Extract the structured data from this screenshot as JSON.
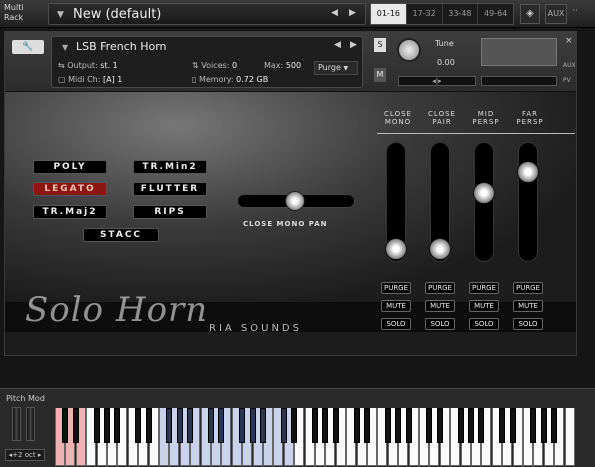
{
  "rack": {
    "label_line1": "Multi",
    "label_line2": "Rack",
    "preset_name": "New (default)",
    "nav_prev": "◀",
    "nav_next": "▶",
    "banks": [
      "01-16",
      "17-32",
      "33-48",
      "49-64"
    ],
    "active_bank": "01-16",
    "aux_label": "AUX",
    "more": "··"
  },
  "instrument": {
    "name": "LSB French Horn",
    "output_label": "Output:",
    "output_value": "st. 1",
    "midi_label": "Midi Ch:",
    "midi_value": "[A] 1",
    "voices_label": "Voices:",
    "voices_value": "0",
    "max_label": "Max:",
    "max_value": "500",
    "memory_label": "Memory:",
    "memory_value": "0.72 GB",
    "purge_label": "Purge",
    "s_label": "S",
    "m_label": "M",
    "tune_label": "Tune",
    "tune_value": "0.00",
    "pan_value": "◂|▸",
    "close_label": "×",
    "aux_mini": "AUX",
    "pv_label": "PV"
  },
  "mics": [
    {
      "line1": "CLOSE",
      "line2": "MONO",
      "level": 0.1
    },
    {
      "line1": "CLOSE",
      "line2": "PAIR",
      "level": 0.1
    },
    {
      "line1": "MID",
      "line2": "PERSP",
      "level": 0.55
    },
    {
      "line1": "FAR",
      "line2": "PERSP",
      "level": 0.8
    }
  ],
  "articulations": {
    "poly": "POLY",
    "legato": "LEGATO",
    "trmaj2": "TR.Maj2",
    "trmin2": "TR.Min2",
    "flutter": "FLUTTER",
    "rips": "RIPS",
    "stacc": "STACC",
    "active": "LEGATO"
  },
  "pan_slider": {
    "label": "CLOSE MONO PAN",
    "value": 0.5
  },
  "mic_buttons": {
    "purge": "PURGE",
    "mute": "MUTE",
    "solo": "SOLO"
  },
  "logo": {
    "title": "Solo Horn",
    "subtitle": "RIA SOUNDS"
  },
  "keyboard": {
    "pitch_mod_label": "Pitch Mod",
    "octave_label": "◂+2 oct ▸",
    "red_keys": "C0-D#0",
    "blue_keys": "C1-F#2"
  },
  "colors": {
    "active_articulation": "#8b1712",
    "red_key": "#f0b3b3",
    "blue_key": "#c9d4ec"
  }
}
